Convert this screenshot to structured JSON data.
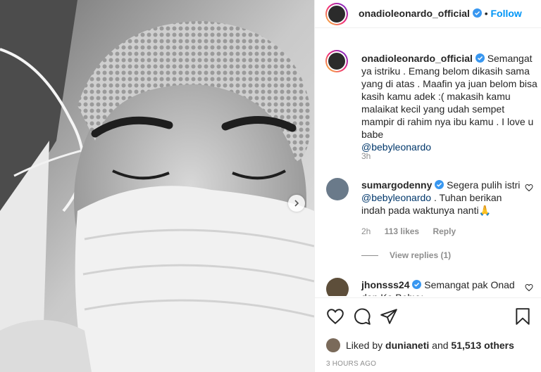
{
  "post": {
    "username": "onadioleonardo_official",
    "separator": "•",
    "follow_label": "Follow"
  },
  "caption": {
    "username": "onadioleonardo_official",
    "text": "Semangat ya istriku . Emang belom dikasih sama yang di atas . Maafin ya juan belom bisa kasih kamu adek :( makasih kamu malaikat kecil yang udah sempet mampir di rahim nya ibu kamu . I love u babe",
    "mention": "@bebyleonardo",
    "time": "3h"
  },
  "comments": [
    {
      "username": "sumargodenny",
      "text_before": "Segera pulih istri",
      "mention": "@bebyleonardo",
      "text_after": ". Tuhan berikan indah pada waktunya nanti🙏",
      "time": "2h",
      "likes": "113 likes",
      "reply_label": "Reply",
      "view_replies": "View replies (1)"
    },
    {
      "username": "jhonsss24",
      "text": "Semangat pak Onad dan Ka Bebyy..."
    }
  ],
  "likes": {
    "prefix": "Liked by",
    "user": "dunianeti",
    "middle": "and",
    "count": "51,513 others"
  },
  "timestamp": "3 HOURS AGO",
  "icons": [
    "heart-icon",
    "comment-icon",
    "share-icon",
    "bookmark-icon",
    "verified-badge-icon",
    "chevron-right-icon"
  ],
  "colors": {
    "accent": "#0095f6",
    "verified": "#3897f0",
    "mention": "#00376b",
    "muted": "#8e8e8e"
  }
}
